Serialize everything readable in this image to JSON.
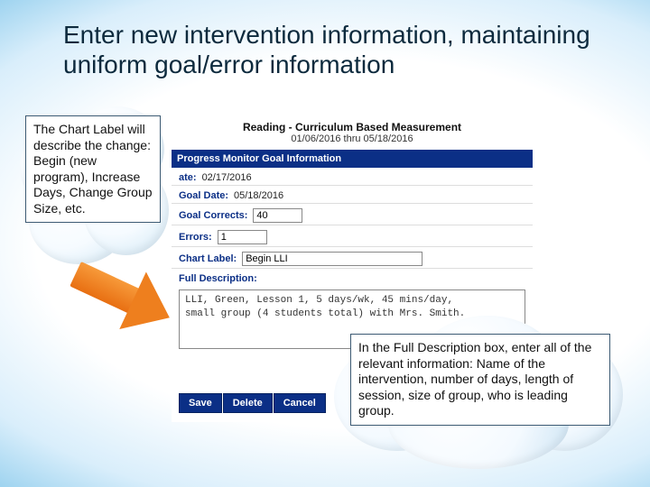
{
  "title": "Enter new intervention information, maintaining uniform goal/error information",
  "callout1": "The Chart Label will describe the change: Begin (new program), Increase Days, Change Group Size, etc.",
  "callout2": "In the Full Description box, enter all of the relevant information: Name of the intervention, number of days, length of session, size of group, who is leading group.",
  "panel": {
    "header": "Reading - Curriculum Based Measurement",
    "date_range": "01/06/2016 thru 05/18/2016",
    "section_bar": "Progress Monitor Goal Information",
    "fields": {
      "date_label": "ate:",
      "date_value": "02/17/2016",
      "goal_date_label": "Goal Date:",
      "goal_date_value": "05/18/2016",
      "goal_corrects_label": "Goal Corrects:",
      "goal_corrects_value": "40",
      "errors_label": "Errors:",
      "errors_value": "1",
      "chart_label_label": "Chart Label:",
      "chart_label_value": "Begin LLI",
      "full_desc_label": "Full Description:",
      "full_desc_value": "LLI, Green, Lesson 1, 5 days/wk, 45 mins/day,\nsmall group (4 students total) with Mrs. Smith."
    },
    "buttons": {
      "save": "Save",
      "delete": "Delete",
      "cancel": "Cancel"
    }
  }
}
